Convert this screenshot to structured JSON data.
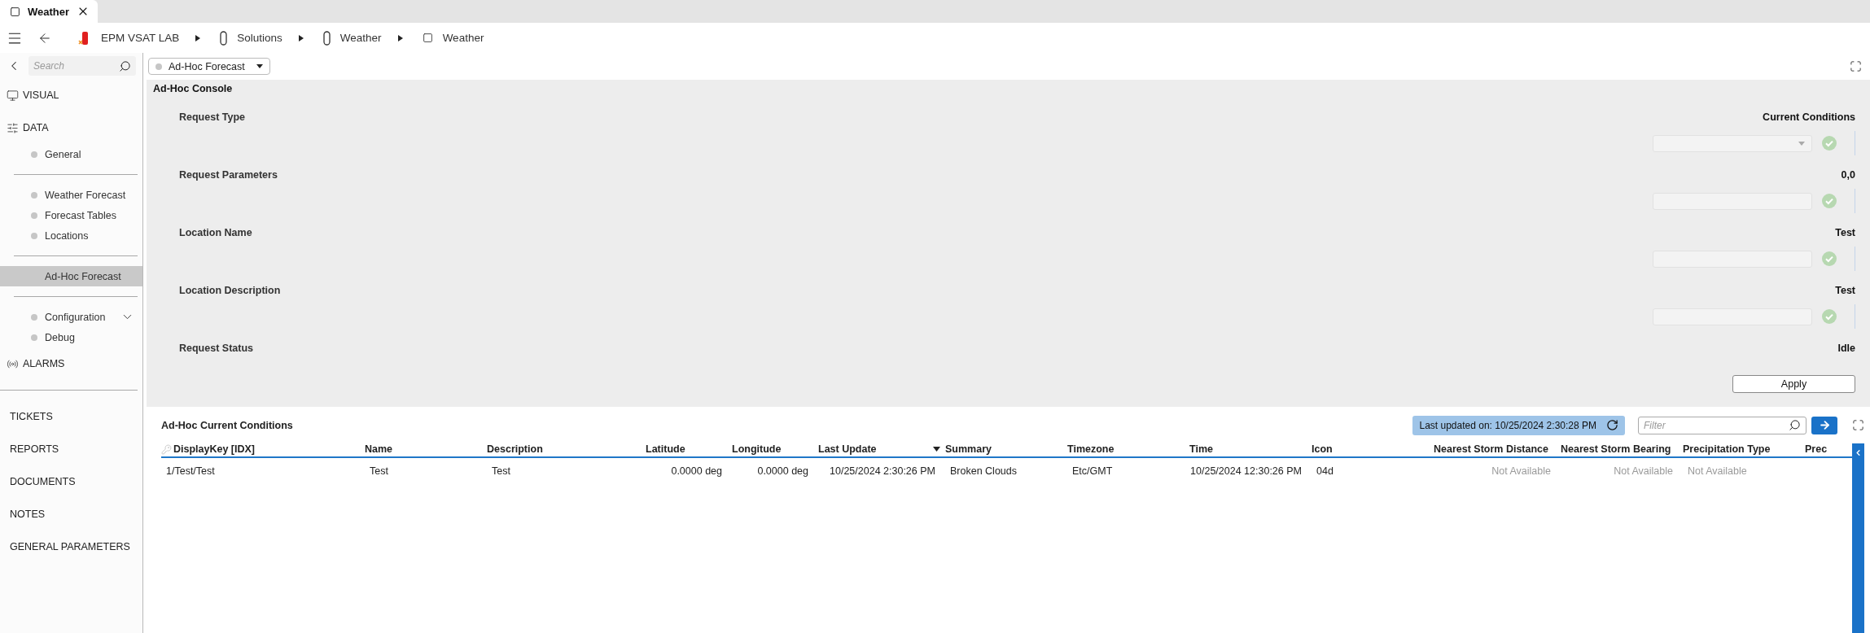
{
  "tab": {
    "label": "Weather"
  },
  "breadcrumb": [
    {
      "label": "EPM VSAT LAB"
    },
    {
      "label": "Solutions"
    },
    {
      "label": "Weather"
    },
    {
      "label": "Weather"
    }
  ],
  "sidebar": {
    "search": {
      "placeholder": "Search"
    },
    "sections": [
      {
        "label": "VISUAL"
      },
      {
        "label": "DATA",
        "groups": [
          [
            {
              "label": "General",
              "selected": false
            }
          ],
          [
            {
              "label": "Weather Forecast",
              "selected": false
            },
            {
              "label": "Forecast Tables",
              "selected": false
            },
            {
              "label": "Locations",
              "selected": false
            }
          ],
          [
            {
              "label": "Ad-Hoc Forecast",
              "selected": true
            }
          ],
          [
            {
              "label": "Configuration",
              "selected": false,
              "expanded": false
            },
            {
              "label": "Debug",
              "selected": false
            }
          ]
        ]
      },
      {
        "label": "ALARMS"
      }
    ],
    "links": [
      "TICKETS",
      "REPORTS",
      "DOCUMENTS",
      "NOTES",
      "GENERAL PARAMETERS"
    ]
  },
  "view_selector": {
    "label": "Ad-Hoc Forecast"
  },
  "console": {
    "title": "Ad-Hoc Console",
    "rows": [
      {
        "label": "Request Type",
        "value": "Current Conditions",
        "field": {
          "kind": "select"
        },
        "valid": true
      },
      {
        "label": "Request Parameters",
        "value": "0,0",
        "field": {
          "kind": "text"
        },
        "valid": true
      },
      {
        "label": "Location Name",
        "value": "Test",
        "field": {
          "kind": "text"
        },
        "valid": true
      },
      {
        "label": "Location Description",
        "value": "Test",
        "field": {
          "kind": "text"
        },
        "valid": true
      },
      {
        "label": "Request Status",
        "value": "Idle"
      }
    ],
    "apply_button": "Apply"
  },
  "table": {
    "title": "Ad-Hoc Current Conditions",
    "last_updated": "Last updated on: 10/25/2024 2:30:28 PM",
    "filter": {
      "placeholder": "Filter"
    },
    "columns": [
      {
        "label": "DisplayKey [IDX]",
        "sorted": false
      },
      {
        "label": "Name",
        "sorted": false
      },
      {
        "label": "Description",
        "sorted": false
      },
      {
        "label": "Latitude",
        "sorted": false
      },
      {
        "label": "Longitude",
        "sorted": false
      },
      {
        "label": "Last Update",
        "sorted": true
      },
      {
        "label": "Summary",
        "sorted": false
      },
      {
        "label": "Timezone",
        "sorted": false
      },
      {
        "label": "Time",
        "sorted": false
      },
      {
        "label": "Icon",
        "sorted": false
      },
      {
        "label": "Nearest Storm Distance",
        "sorted": false
      },
      {
        "label": "Nearest Storm Bearing",
        "sorted": false
      },
      {
        "label": "Precipitation Type",
        "sorted": false
      },
      {
        "label": "Prec",
        "sorted": false
      }
    ],
    "rows": [
      {
        "cells": [
          {
            "text": "1/Test/Test",
            "muted": false
          },
          {
            "text": "Test",
            "muted": false
          },
          {
            "text": "Test",
            "muted": false
          },
          {
            "text": "0.0000 deg",
            "muted": false
          },
          {
            "text": "0.0000 deg",
            "muted": false
          },
          {
            "text": "10/25/2024 2:30:26 PM",
            "muted": false
          },
          {
            "text": "Broken Clouds",
            "muted": false
          },
          {
            "text": "Etc/GMT",
            "muted": false
          },
          {
            "text": "10/25/2024 12:30:26 PM",
            "muted": false
          },
          {
            "text": "04d",
            "muted": false
          },
          {
            "text": "Not Available",
            "muted": true
          },
          {
            "text": "Not Available",
            "muted": true
          },
          {
            "text": "Not Available",
            "muted": true
          }
        ]
      }
    ]
  }
}
